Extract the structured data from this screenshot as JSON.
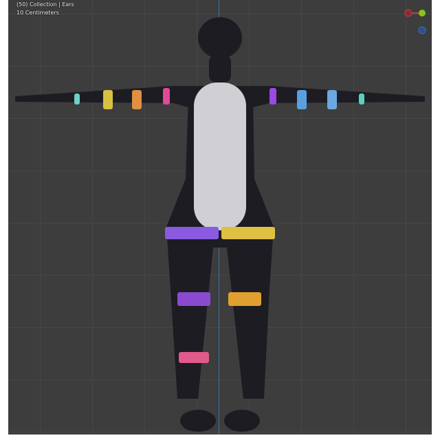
{
  "viewport": {
    "overlay_line1": "(50) Collection | Ears",
    "overlay_line2": "10 Centimeters"
  },
  "gizmo": {
    "x_color": "#c23a4a",
    "y_color": "#8cc21a",
    "z_color": "#3a6fc2"
  },
  "model": {
    "band_colors": [
      "#6fd0c8",
      "#d8c040",
      "#e09040",
      "#e04a9a",
      "#9a4ae0",
      "#5aa0e0",
      "#6aa8e0",
      "#5ad0c0",
      "#8a5ae0",
      "#e0c040",
      "#8a4ad0",
      "#e0a030",
      "#e05a8a"
    ]
  }
}
